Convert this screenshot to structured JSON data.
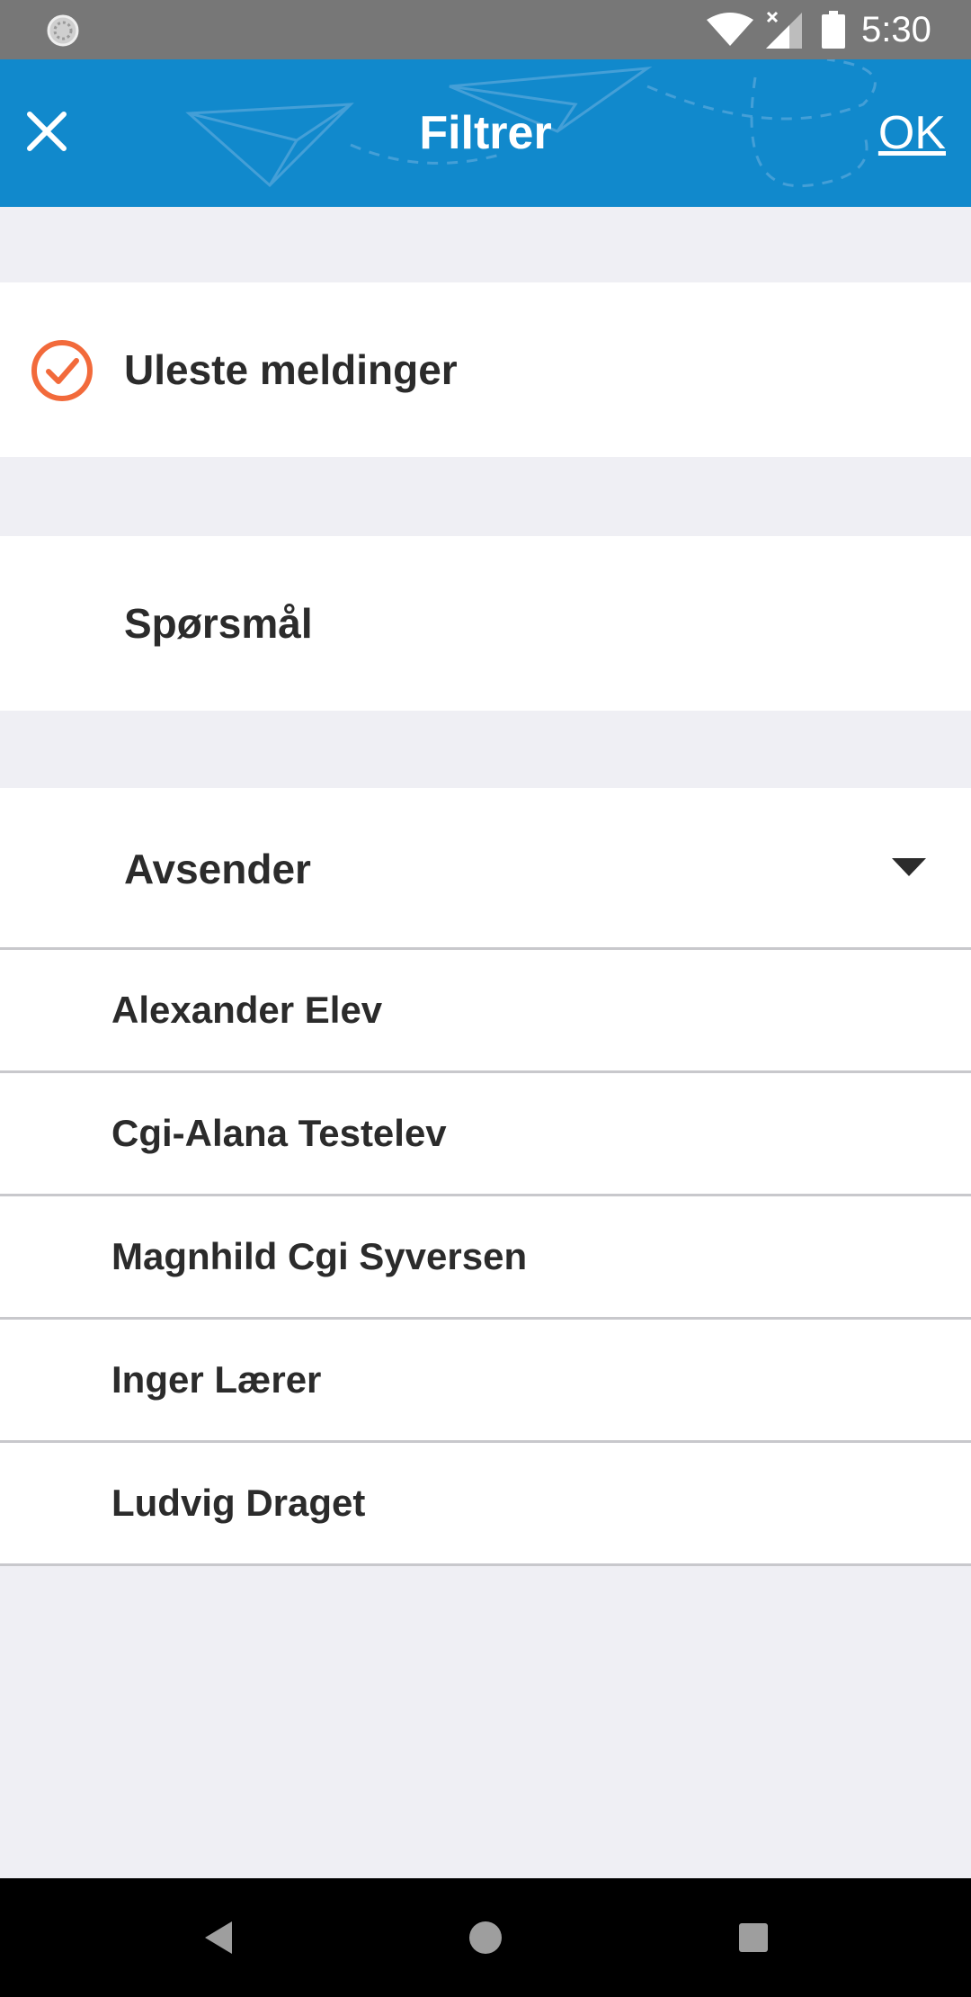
{
  "status_bar": {
    "time": "5:30",
    "icons": [
      "notification-icon",
      "wifi-icon",
      "signal-icon",
      "battery-icon"
    ]
  },
  "app_bar": {
    "title": "Filtrer",
    "ok_label": "OK",
    "close_icon": "close-icon",
    "background_color": "#1189cc"
  },
  "filters": {
    "unread": {
      "label": "Uleste meldinger",
      "checked": true,
      "accent_color": "#f26a3b"
    },
    "questions": {
      "label": "Spørsmål",
      "checked": false
    },
    "sender": {
      "label": "Avsender",
      "expanded": true,
      "options": [
        {
          "label": "Alexander Elev"
        },
        {
          "label": "Cgi-Alana Testelev"
        },
        {
          "label": "Magnhild Cgi Syversen"
        },
        {
          "label": "Inger Lærer"
        },
        {
          "label": "Ludvig Draget"
        }
      ]
    }
  },
  "nav_bar": {
    "icons": [
      "back-icon",
      "home-icon",
      "recents-icon"
    ]
  }
}
